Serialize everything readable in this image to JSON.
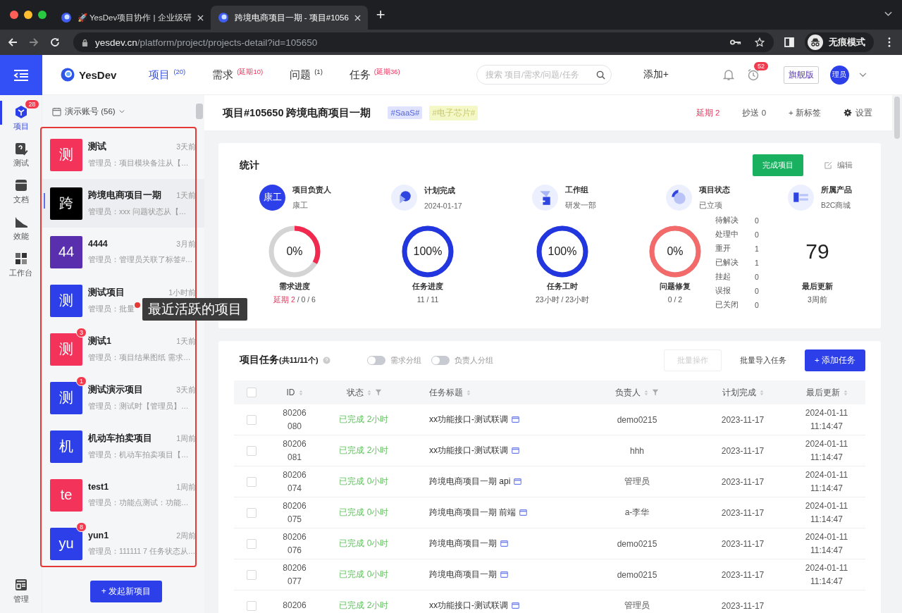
{
  "browser": {
    "tabs": [
      {
        "title": "🚀 YesDev项目协作 | 企业级研",
        "selected": false
      },
      {
        "title": "跨境电商项目一期 - 项目#1056",
        "selected": true
      }
    ],
    "new_tab": "+",
    "address": {
      "host": "yesdev.cn",
      "path": "/platform/project/projects-detail?id=105650"
    },
    "profile": "无痕模式"
  },
  "header": {
    "brand": "YesDev",
    "nav": [
      {
        "label": "项目",
        "count": "(20)",
        "selected": true,
        "alert": false
      },
      {
        "label": "需求",
        "count": "(延期10)",
        "selected": false,
        "alert": true
      },
      {
        "label": "问题",
        "count": "(1)",
        "selected": false,
        "alert": false
      },
      {
        "label": "任务",
        "count": "(延期36)",
        "selected": false,
        "alert": true
      }
    ],
    "search": {
      "placeholder": "搜索 项目/需求/问题/任务"
    },
    "add": "添加+",
    "alarm_badge": "52",
    "edition": "旗舰版",
    "user": "理员"
  },
  "rail": {
    "items": [
      {
        "label": "项目",
        "selected": true,
        "badge": "28"
      },
      {
        "label": "测试",
        "selected": false
      },
      {
        "label": "文档",
        "selected": false
      },
      {
        "label": "效能",
        "selected": false
      },
      {
        "label": "工作台",
        "selected": false
      }
    ],
    "bottom": {
      "label": "管理",
      "selected": false
    }
  },
  "projects": {
    "account": "演示账号 (56)",
    "items": [
      {
        "avatar": "测",
        "color": "#f4335b",
        "name": "测试",
        "time": "3天前",
        "activity": "管理员：项目模块备注从【…",
        "selected": false
      },
      {
        "avatar": "跨",
        "color": "#000000",
        "name": "跨境电商项目一期",
        "time": "1天前",
        "activity": "管理员：xxx 问题状态从【…",
        "selected": true
      },
      {
        "avatar": "44",
        "color": "#5a2fae",
        "name": "4444",
        "time": "3月前",
        "activity": "管理员：管理员关联了标签#…",
        "selected": false
      },
      {
        "avatar": "测",
        "color": "#2c3fe8",
        "name": "测试项目",
        "time": "1小时前",
        "activity": "管理员：批量",
        "selected": false
      },
      {
        "avatar": "测",
        "color": "#f4335b",
        "name": "测试1",
        "time": "1天前",
        "activity": "管理员：项目结果图纸 需求…",
        "selected": false,
        "badge": "3"
      },
      {
        "avatar": "测",
        "color": "#2c3fe8",
        "name": "测试演示项目",
        "time": "3天前",
        "activity": "管理员：测试时【管理员】…",
        "selected": false,
        "badge": "1"
      },
      {
        "avatar": "机",
        "color": "#2c3fe8",
        "name": "机动车拍卖项目",
        "time": "1周前",
        "activity": "管理员：机动车拍卖项目【…",
        "selected": false
      },
      {
        "avatar": "te",
        "color": "#f4335b",
        "name": "test1",
        "time": "1周前",
        "activity": "管理员：功能点测试：功能…",
        "selected": false
      },
      {
        "avatar": "yu",
        "color": "#2c3fe8",
        "name": "yun1",
        "time": "2周前",
        "activity": "管理员：111111 7 任务状态从…",
        "selected": false,
        "badge": "8"
      }
    ],
    "new_button": "+ 发起新项目",
    "annotation": "最近活跃的项目"
  },
  "project": {
    "title": "项目#105650 跨境电商项目一期",
    "tags": [
      {
        "label": "#SaaS#",
        "color": "#dfe3ff"
      },
      {
        "label": "#电子芯片#",
        "color": "#f4f8c6"
      }
    ],
    "actions": [
      {
        "label": "延期 2",
        "kind": "alert"
      },
      {
        "label": "抄送 0",
        "kind": "plain"
      },
      {
        "label": "+ 新标签",
        "kind": "plain"
      },
      {
        "label": "设置",
        "kind": "settings"
      }
    ]
  },
  "stats": {
    "title": "统计",
    "complete": "完成项目",
    "edit": "编辑",
    "info": [
      {
        "label": "项目负责人",
        "value": "康工",
        "avatar": "康工"
      },
      {
        "label": "计划完成",
        "value": "2024-01-17"
      },
      {
        "label": "工作组",
        "value": "研发一部"
      },
      {
        "label": "项目状态",
        "value": "已立项"
      },
      {
        "label": "所属产品",
        "value": "B2C商城"
      }
    ],
    "rings": [
      {
        "percent": "0%",
        "level": 0.33,
        "color": "#f2294f",
        "label": "需求进度",
        "delay": "延期 2",
        "value": "/ 0 / 6"
      },
      {
        "percent": "100%",
        "level": 1,
        "color": "#2236e0",
        "label": "任务进度",
        "value": "11 / 11"
      },
      {
        "percent": "100%",
        "level": 1,
        "color": "#2236e0",
        "label": "任务工时",
        "value": "23小时 / 23小时"
      },
      {
        "percent": "0%",
        "level": 1,
        "color": "#f26a6a",
        "label": "问题修复",
        "value": "0 / 2"
      }
    ],
    "issue_states": [
      {
        "label": "待解决",
        "count": "0"
      },
      {
        "label": "处理中",
        "count": "0"
      },
      {
        "label": "重开",
        "count": "1"
      },
      {
        "label": "已解决",
        "count": "1"
      },
      {
        "label": "挂起",
        "count": "0"
      },
      {
        "label": "误报",
        "count": "0"
      },
      {
        "label": "已关闭",
        "count": "0"
      }
    ],
    "updates": {
      "value": "79",
      "label": "最后更新",
      "ago": "3周前"
    }
  },
  "tasks": {
    "title": "项目任务",
    "total": "(共11/11个)",
    "toggles": [
      {
        "label": "需求分组",
        "on": false
      },
      {
        "label": "负责人分组",
        "on": false
      }
    ],
    "batch": {
      "label": "批量操作",
      "disabled": true
    },
    "import": "批量导入任务",
    "add": "+ 添加任务",
    "select_all": {
      "checked": false
    },
    "columns": [
      {
        "label": "ID",
        "filter": false
      },
      {
        "label": "状态",
        "filter": true
      },
      {
        "label": "任务标题",
        "filter": false
      },
      {
        "label": "负责人",
        "filter": true
      },
      {
        "label": "计划完成",
        "filter": false
      },
      {
        "label": "最后更新",
        "filter": false
      }
    ],
    "rows": [
      {
        "checked": false,
        "id": [
          "80206",
          "080"
        ],
        "status": "已完成 2小时",
        "title": "xx功能接口-测试联调",
        "owner": "demo0215",
        "due": "2023-11-17",
        "updated": [
          "2024-01-11",
          "11:14:47"
        ]
      },
      {
        "checked": false,
        "id": [
          "80206",
          "081"
        ],
        "status": "已完成 2小时",
        "title": "xx功能接口-测试联调",
        "owner": "hhh",
        "due": "2023-11-17",
        "updated": [
          "2024-01-11",
          "11:14:47"
        ]
      },
      {
        "checked": false,
        "id": [
          "80206",
          "074"
        ],
        "status": "已完成 0小时",
        "title": "跨境电商项目一期 api",
        "owner": "管理员",
        "due": "2023-11-17",
        "updated": [
          "2024-01-11",
          "11:14:47"
        ]
      },
      {
        "checked": false,
        "id": [
          "80206",
          "075"
        ],
        "status": "已完成 0小时",
        "title": "跨境电商项目一期 前端",
        "owner": "a-李华",
        "due": "2023-11-17",
        "updated": [
          "2024-01-11",
          "11:14:47"
        ]
      },
      {
        "checked": false,
        "id": [
          "80206",
          "076"
        ],
        "status": "已完成 0小时",
        "title": "跨境电商项目一期",
        "owner": "demo0215",
        "due": "2023-11-17",
        "updated": [
          "2024-01-11",
          "11:14:47"
        ]
      },
      {
        "checked": false,
        "id": [
          "80206",
          "077"
        ],
        "status": "已完成 0小时",
        "title": "跨境电商项目一期",
        "owner": "demo0215",
        "due": "2023-11-17",
        "updated": [
          "2024-01-11",
          "11:14:47"
        ]
      },
      {
        "checked": false,
        "id": [
          "80206"
        ],
        "status": "已完成 2小时",
        "title": "xx功能接口-测试联调",
        "owner": "管理员",
        "due": "2023-11-17"
      }
    ]
  }
}
